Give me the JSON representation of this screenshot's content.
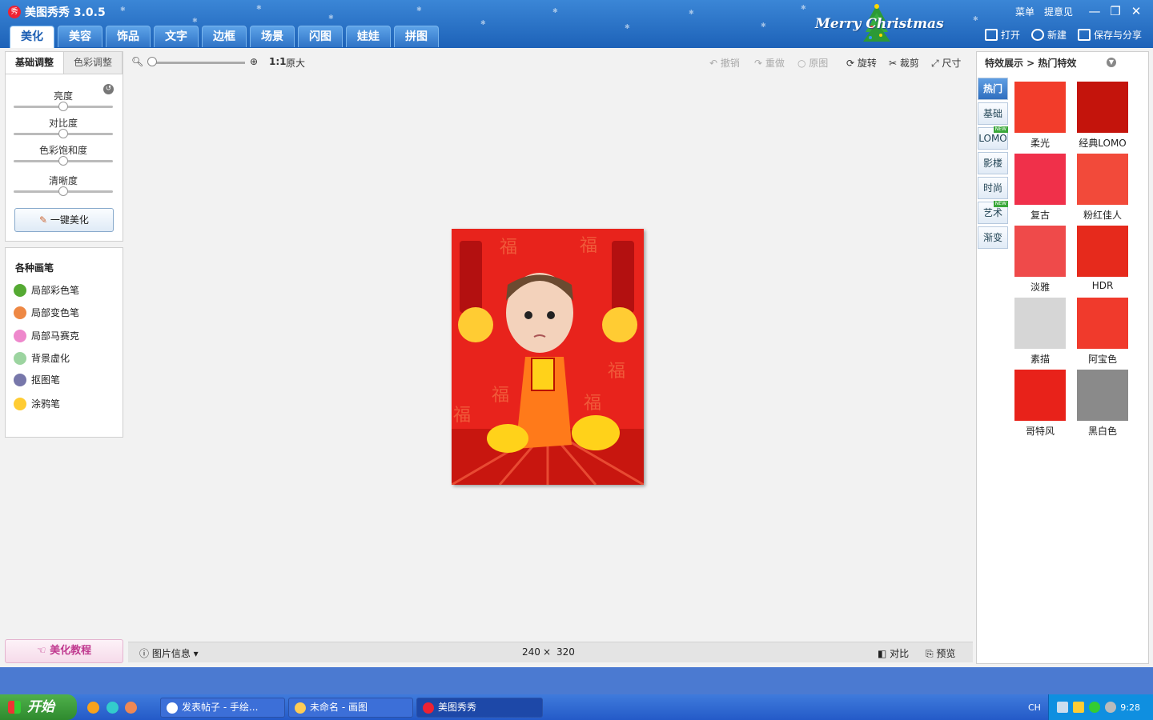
{
  "app": {
    "title": "美图秀秀 3.0.5",
    "logo": "秀"
  },
  "main_tabs": [
    "美化",
    "美容",
    "饰品",
    "文字",
    "边框",
    "场景",
    "闪图",
    "娃娃",
    "拼图"
  ],
  "active_tab": "美化",
  "banner": {
    "text": "Merry Christmas"
  },
  "top_links": {
    "menu": "菜单",
    "feedback": "提意见"
  },
  "window_controls": {
    "minimize": "—",
    "maximize": "❐",
    "close": "✕"
  },
  "top_actions": {
    "open": "打开",
    "new": "新建",
    "save": "保存与分享"
  },
  "left": {
    "subtabs": [
      "基础调整",
      "色彩调整"
    ],
    "adjustments": [
      {
        "label": "亮度",
        "value": 0.5
      },
      {
        "label": "对比度",
        "value": 0.5
      },
      {
        "label": "色彩饱和度",
        "value": 0.5
      },
      {
        "label": "清晰度",
        "value": 0.5
      }
    ],
    "auto_button": "一键美化",
    "brush_title": "各种画笔",
    "brushes": [
      "局部彩色笔",
      "局部变色笔",
      "局部马赛克",
      "背景虚化",
      "抠图笔",
      "涂鸦笔"
    ],
    "tutorial": "美化教程"
  },
  "toolbar": {
    "zoom_ratio": "1:1",
    "original_size": "原大",
    "undo": "撤销",
    "redo": "重做",
    "original": "原图",
    "rotate": "旋转",
    "crop": "裁剪",
    "resize": "尺寸"
  },
  "status": {
    "info": "图片信息",
    "width": "240",
    "times": "×",
    "height": "320",
    "compare": "对比",
    "preview": "预览"
  },
  "effects": {
    "breadcrumb": "特效展示 > 热门特效",
    "categories": [
      "热门",
      "基础",
      "LOMO",
      "影楼",
      "时尚",
      "艺术",
      "渐变"
    ],
    "new_badge": "NEW",
    "items": [
      "柔光",
      "经典LOMO",
      "复古",
      "粉红佳人",
      "淡雅",
      "HDR",
      "素描",
      "阿宝色",
      "哥特风",
      "黑白色"
    ]
  },
  "taskbar": {
    "start": "开始",
    "tasks": [
      "发表帖子 - 手绘...",
      "未命名 - 画图",
      "美图秀秀"
    ],
    "lang": "CH",
    "clock": "9:28"
  },
  "colors": {
    "accent": "#1d62b8",
    "photo_red": "#e8231c"
  }
}
